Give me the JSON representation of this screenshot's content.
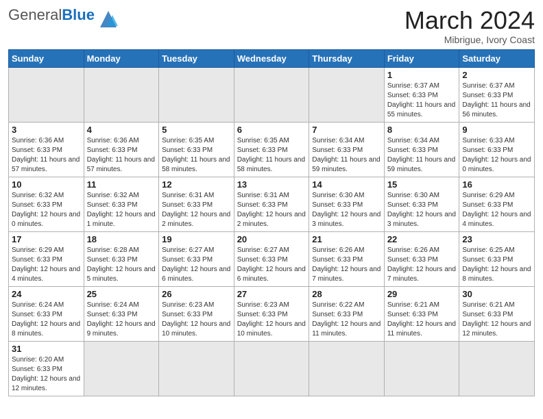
{
  "logo": {
    "text_general": "General",
    "text_blue": "Blue"
  },
  "title": "March 2024",
  "subtitle": "Mibrigue, Ivory Coast",
  "days_of_week": [
    "Sunday",
    "Monday",
    "Tuesday",
    "Wednesday",
    "Thursday",
    "Friday",
    "Saturday"
  ],
  "weeks": [
    [
      {
        "day": "",
        "info": "",
        "empty": true
      },
      {
        "day": "",
        "info": "",
        "empty": true
      },
      {
        "day": "",
        "info": "",
        "empty": true
      },
      {
        "day": "",
        "info": "",
        "empty": true
      },
      {
        "day": "",
        "info": "",
        "empty": true
      },
      {
        "day": "1",
        "info": "Sunrise: 6:37 AM\nSunset: 6:33 PM\nDaylight: 11 hours\nand 55 minutes.",
        "empty": false
      },
      {
        "day": "2",
        "info": "Sunrise: 6:37 AM\nSunset: 6:33 PM\nDaylight: 11 hours\nand 56 minutes.",
        "empty": false
      }
    ],
    [
      {
        "day": "3",
        "info": "Sunrise: 6:36 AM\nSunset: 6:33 PM\nDaylight: 11 hours\nand 57 minutes.",
        "empty": false
      },
      {
        "day": "4",
        "info": "Sunrise: 6:36 AM\nSunset: 6:33 PM\nDaylight: 11 hours\nand 57 minutes.",
        "empty": false
      },
      {
        "day": "5",
        "info": "Sunrise: 6:35 AM\nSunset: 6:33 PM\nDaylight: 11 hours\nand 58 minutes.",
        "empty": false
      },
      {
        "day": "6",
        "info": "Sunrise: 6:35 AM\nSunset: 6:33 PM\nDaylight: 11 hours\nand 58 minutes.",
        "empty": false
      },
      {
        "day": "7",
        "info": "Sunrise: 6:34 AM\nSunset: 6:33 PM\nDaylight: 11 hours\nand 59 minutes.",
        "empty": false
      },
      {
        "day": "8",
        "info": "Sunrise: 6:34 AM\nSunset: 6:33 PM\nDaylight: 11 hours\nand 59 minutes.",
        "empty": false
      },
      {
        "day": "9",
        "info": "Sunrise: 6:33 AM\nSunset: 6:33 PM\nDaylight: 12 hours\nand 0 minutes.",
        "empty": false
      }
    ],
    [
      {
        "day": "10",
        "info": "Sunrise: 6:32 AM\nSunset: 6:33 PM\nDaylight: 12 hours\nand 0 minutes.",
        "empty": false
      },
      {
        "day": "11",
        "info": "Sunrise: 6:32 AM\nSunset: 6:33 PM\nDaylight: 12 hours\nand 1 minute.",
        "empty": false
      },
      {
        "day": "12",
        "info": "Sunrise: 6:31 AM\nSunset: 6:33 PM\nDaylight: 12 hours\nand 2 minutes.",
        "empty": false
      },
      {
        "day": "13",
        "info": "Sunrise: 6:31 AM\nSunset: 6:33 PM\nDaylight: 12 hours\nand 2 minutes.",
        "empty": false
      },
      {
        "day": "14",
        "info": "Sunrise: 6:30 AM\nSunset: 6:33 PM\nDaylight: 12 hours\nand 3 minutes.",
        "empty": false
      },
      {
        "day": "15",
        "info": "Sunrise: 6:30 AM\nSunset: 6:33 PM\nDaylight: 12 hours\nand 3 minutes.",
        "empty": false
      },
      {
        "day": "16",
        "info": "Sunrise: 6:29 AM\nSunset: 6:33 PM\nDaylight: 12 hours\nand 4 minutes.",
        "empty": false
      }
    ],
    [
      {
        "day": "17",
        "info": "Sunrise: 6:29 AM\nSunset: 6:33 PM\nDaylight: 12 hours\nand 4 minutes.",
        "empty": false
      },
      {
        "day": "18",
        "info": "Sunrise: 6:28 AM\nSunset: 6:33 PM\nDaylight: 12 hours\nand 5 minutes.",
        "empty": false
      },
      {
        "day": "19",
        "info": "Sunrise: 6:27 AM\nSunset: 6:33 PM\nDaylight: 12 hours\nand 6 minutes.",
        "empty": false
      },
      {
        "day": "20",
        "info": "Sunrise: 6:27 AM\nSunset: 6:33 PM\nDaylight: 12 hours\nand 6 minutes.",
        "empty": false
      },
      {
        "day": "21",
        "info": "Sunrise: 6:26 AM\nSunset: 6:33 PM\nDaylight: 12 hours\nand 7 minutes.",
        "empty": false
      },
      {
        "day": "22",
        "info": "Sunrise: 6:26 AM\nSunset: 6:33 PM\nDaylight: 12 hours\nand 7 minutes.",
        "empty": false
      },
      {
        "day": "23",
        "info": "Sunrise: 6:25 AM\nSunset: 6:33 PM\nDaylight: 12 hours\nand 8 minutes.",
        "empty": false
      }
    ],
    [
      {
        "day": "24",
        "info": "Sunrise: 6:24 AM\nSunset: 6:33 PM\nDaylight: 12 hours\nand 8 minutes.",
        "empty": false
      },
      {
        "day": "25",
        "info": "Sunrise: 6:24 AM\nSunset: 6:33 PM\nDaylight: 12 hours\nand 9 minutes.",
        "empty": false
      },
      {
        "day": "26",
        "info": "Sunrise: 6:23 AM\nSunset: 6:33 PM\nDaylight: 12 hours\nand 10 minutes.",
        "empty": false
      },
      {
        "day": "27",
        "info": "Sunrise: 6:23 AM\nSunset: 6:33 PM\nDaylight: 12 hours\nand 10 minutes.",
        "empty": false
      },
      {
        "day": "28",
        "info": "Sunrise: 6:22 AM\nSunset: 6:33 PM\nDaylight: 12 hours\nand 11 minutes.",
        "empty": false
      },
      {
        "day": "29",
        "info": "Sunrise: 6:21 AM\nSunset: 6:33 PM\nDaylight: 12 hours\nand 11 minutes.",
        "empty": false
      },
      {
        "day": "30",
        "info": "Sunrise: 6:21 AM\nSunset: 6:33 PM\nDaylight: 12 hours\nand 12 minutes.",
        "empty": false
      }
    ],
    [
      {
        "day": "31",
        "info": "Sunrise: 6:20 AM\nSunset: 6:33 PM\nDaylight: 12 hours\nand 12 minutes.",
        "empty": false
      },
      {
        "day": "",
        "info": "",
        "empty": true
      },
      {
        "day": "",
        "info": "",
        "empty": true
      },
      {
        "day": "",
        "info": "",
        "empty": true
      },
      {
        "day": "",
        "info": "",
        "empty": true
      },
      {
        "day": "",
        "info": "",
        "empty": true
      },
      {
        "day": "",
        "info": "",
        "empty": true
      }
    ]
  ]
}
